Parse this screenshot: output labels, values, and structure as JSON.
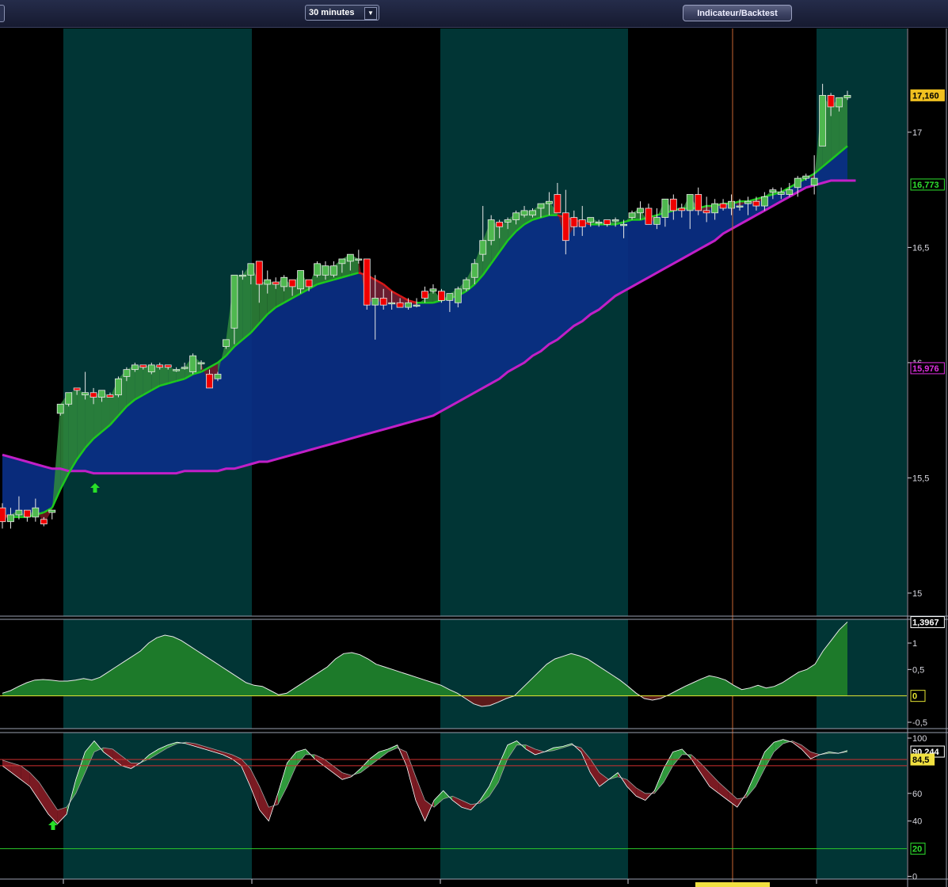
{
  "toolbar": {
    "timeframe": "30 minutes",
    "indicator_button": "Indicateur/Backtest"
  },
  "chart_data": [
    {
      "type": "candlestick",
      "ylim": [
        14.9,
        17.45
      ],
      "yticks": [
        "17",
        "16,5",
        "16",
        "15,5",
        "15"
      ],
      "last_values": {
        "price": "17,160",
        "fast_ma": "16,773",
        "slow_ma": "15,976"
      },
      "ohlc": [
        [
          15.37,
          15.39,
          15.28,
          15.31
        ],
        [
          15.31,
          15.37,
          15.28,
          15.34
        ],
        [
          15.34,
          15.42,
          15.32,
          15.36
        ],
        [
          15.36,
          15.36,
          15.31,
          15.33
        ],
        [
          15.33,
          15.41,
          15.31,
          15.37
        ],
        [
          15.32,
          15.33,
          15.29,
          15.3
        ],
        [
          15.35,
          15.36,
          15.32,
          15.36
        ],
        [
          15.78,
          15.82,
          15.77,
          15.82
        ],
        [
          15.82,
          15.87,
          15.81,
          15.87
        ],
        [
          15.89,
          15.89,
          15.86,
          15.88
        ],
        [
          15.86,
          15.96,
          15.84,
          15.87
        ],
        [
          15.87,
          15.89,
          15.82,
          15.85
        ],
        [
          15.85,
          15.88,
          15.83,
          15.88
        ],
        [
          15.86,
          15.87,
          15.85,
          15.85
        ],
        [
          15.86,
          15.94,
          15.85,
          15.93
        ],
        [
          15.94,
          15.98,
          15.92,
          15.97
        ],
        [
          15.97,
          16.0,
          15.96,
          15.99
        ],
        [
          15.99,
          15.99,
          15.97,
          15.98
        ],
        [
          15.96,
          16.0,
          15.95,
          15.99
        ],
        [
          15.99,
          16.0,
          15.97,
          15.98
        ],
        [
          15.99,
          15.99,
          15.97,
          15.98
        ],
        [
          15.97,
          15.98,
          15.96,
          15.97
        ],
        [
          15.98,
          16.0,
          15.97,
          15.98
        ],
        [
          15.96,
          16.04,
          15.95,
          16.03
        ],
        [
          16.0,
          16.01,
          15.97,
          16.0
        ],
        [
          15.95,
          15.97,
          15.89,
          15.89
        ],
        [
          15.93,
          15.96,
          15.92,
          15.95
        ],
        [
          16.07,
          16.1,
          16.06,
          16.1
        ],
        [
          16.15,
          16.32,
          16.08,
          16.38
        ],
        [
          16.38,
          16.4,
          16.36,
          16.38
        ],
        [
          16.38,
          16.43,
          16.34,
          16.43
        ],
        [
          16.44,
          16.44,
          16.26,
          16.34
        ],
        [
          16.34,
          16.4,
          16.3,
          16.36
        ],
        [
          16.35,
          16.37,
          16.32,
          16.34
        ],
        [
          16.33,
          16.38,
          16.31,
          16.37
        ],
        [
          16.36,
          16.36,
          16.29,
          16.33
        ],
        [
          16.32,
          16.4,
          16.3,
          16.4
        ],
        [
          16.36,
          16.36,
          16.31,
          16.33
        ],
        [
          16.38,
          16.44,
          16.37,
          16.43
        ],
        [
          16.38,
          16.44,
          16.36,
          16.42
        ],
        [
          16.38,
          16.44,
          16.37,
          16.42
        ],
        [
          16.43,
          16.45,
          16.39,
          16.45
        ],
        [
          16.44,
          16.47,
          16.4,
          16.47
        ],
        [
          16.45,
          16.49,
          16.43,
          16.45
        ],
        [
          16.45,
          16.45,
          16.23,
          16.25
        ],
        [
          16.25,
          16.38,
          16.1,
          16.28
        ],
        [
          16.28,
          16.32,
          16.23,
          16.25
        ],
        [
          16.26,
          16.31,
          16.23,
          16.26
        ],
        [
          16.26,
          16.28,
          16.24,
          16.24
        ],
        [
          16.24,
          16.28,
          16.23,
          16.26
        ],
        [
          16.25,
          16.28,
          16.24,
          16.25
        ],
        [
          16.31,
          16.33,
          16.26,
          16.28
        ],
        [
          16.31,
          16.34,
          16.3,
          16.32
        ],
        [
          16.31,
          16.32,
          16.26,
          16.27
        ],
        [
          16.27,
          16.3,
          16.22,
          16.3
        ],
        [
          16.26,
          16.33,
          16.24,
          16.32
        ],
        [
          16.32,
          16.37,
          16.31,
          16.36
        ],
        [
          16.37,
          16.45,
          16.34,
          16.43
        ],
        [
          16.47,
          16.68,
          16.44,
          16.53
        ],
        [
          16.53,
          16.64,
          16.51,
          16.62
        ],
        [
          16.61,
          16.62,
          16.54,
          16.59
        ],
        [
          16.61,
          16.63,
          16.58,
          16.62
        ],
        [
          16.62,
          16.66,
          16.6,
          16.65
        ],
        [
          16.64,
          16.68,
          16.63,
          16.66
        ],
        [
          16.64,
          16.67,
          16.63,
          16.66
        ],
        [
          16.67,
          16.69,
          16.63,
          16.69
        ],
        [
          16.69,
          16.74,
          16.64,
          16.7
        ],
        [
          16.73,
          16.78,
          16.69,
          16.65
        ],
        [
          16.65,
          16.75,
          16.47,
          16.53
        ],
        [
          16.63,
          16.66,
          16.55,
          16.59
        ],
        [
          16.62,
          16.68,
          16.55,
          16.59
        ],
        [
          16.61,
          16.63,
          16.59,
          16.63
        ],
        [
          16.61,
          16.62,
          16.59,
          16.61
        ],
        [
          16.62,
          16.62,
          16.59,
          16.6
        ],
        [
          16.62,
          16.63,
          16.59,
          16.62
        ],
        [
          16.6,
          16.62,
          16.54,
          16.6
        ],
        [
          16.63,
          16.66,
          16.62,
          16.65
        ],
        [
          16.65,
          16.7,
          16.62,
          16.67
        ],
        [
          16.67,
          16.69,
          16.6,
          16.6
        ],
        [
          16.6,
          16.67,
          16.58,
          16.63
        ],
        [
          16.63,
          16.71,
          16.59,
          16.71
        ],
        [
          16.71,
          16.73,
          16.62,
          16.66
        ],
        [
          16.67,
          16.69,
          16.63,
          16.66
        ],
        [
          16.66,
          16.73,
          16.58,
          16.73
        ],
        [
          16.73,
          16.76,
          16.64,
          16.66
        ],
        [
          16.66,
          16.72,
          16.61,
          16.65
        ],
        [
          16.65,
          16.71,
          16.62,
          16.69
        ],
        [
          16.69,
          16.71,
          16.66,
          16.67
        ],
        [
          16.67,
          16.73,
          16.64,
          16.7
        ],
        [
          16.68,
          16.71,
          16.66,
          16.68
        ],
        [
          16.69,
          16.72,
          16.64,
          16.7
        ],
        [
          16.7,
          16.72,
          16.66,
          16.68
        ],
        [
          16.68,
          16.74,
          16.66,
          16.72
        ],
        [
          16.74,
          16.76,
          16.71,
          16.75
        ],
        [
          16.73,
          16.76,
          16.71,
          16.74
        ],
        [
          16.73,
          16.78,
          16.72,
          16.75
        ],
        [
          16.76,
          16.81,
          16.72,
          16.8
        ],
        [
          16.8,
          16.82,
          16.79,
          16.81
        ],
        [
          16.77,
          16.9,
          16.73,
          16.8
        ],
        [
          16.94,
          17.21,
          16.98,
          17.16
        ],
        [
          17.16,
          17.17,
          17.07,
          17.11
        ],
        [
          17.11,
          17.15,
          17.09,
          17.15
        ],
        [
          17.15,
          17.18,
          17.14,
          17.16
        ]
      ],
      "fast_ma": [
        15.34,
        15.33,
        15.33,
        15.33,
        15.34,
        15.35,
        15.37,
        15.45,
        15.52,
        15.58,
        15.63,
        15.67,
        15.7,
        15.73,
        15.77,
        15.81,
        15.84,
        15.86,
        15.88,
        15.9,
        15.91,
        15.92,
        15.93,
        15.95,
        15.96,
        15.98,
        16.0,
        16.03,
        16.07,
        16.1,
        16.13,
        16.17,
        16.21,
        16.24,
        16.26,
        16.28,
        16.3,
        16.32,
        16.34,
        16.35,
        16.36,
        16.37,
        16.38,
        16.39,
        16.38,
        16.36,
        16.34,
        16.31,
        16.29,
        16.27,
        16.26,
        16.26,
        16.26,
        16.27,
        16.28,
        16.29,
        16.31,
        16.34,
        16.38,
        16.43,
        16.48,
        16.53,
        16.57,
        16.6,
        16.62,
        16.63,
        16.64,
        16.64,
        16.63,
        16.62,
        16.61,
        16.6,
        16.6,
        16.6,
        16.6,
        16.61,
        16.62,
        16.62,
        16.63,
        16.64,
        16.65,
        16.66,
        16.67,
        16.67,
        16.67,
        16.68,
        16.68,
        16.69,
        16.69,
        16.7,
        16.7,
        16.71,
        16.72,
        16.73,
        16.74,
        16.76,
        16.78,
        16.8,
        16.82,
        16.85,
        16.88,
        16.91,
        16.94,
        16.96
      ],
      "slow_ma": [
        15.6,
        15.59,
        15.58,
        15.57,
        15.56,
        15.55,
        15.54,
        15.54,
        15.53,
        15.53,
        15.53,
        15.52,
        15.52,
        15.52,
        15.52,
        15.52,
        15.52,
        15.52,
        15.52,
        15.52,
        15.52,
        15.52,
        15.53,
        15.53,
        15.53,
        15.53,
        15.53,
        15.54,
        15.54,
        15.55,
        15.56,
        15.57,
        15.57,
        15.58,
        15.59,
        15.6,
        15.61,
        15.62,
        15.63,
        15.64,
        15.65,
        15.66,
        15.67,
        15.68,
        15.69,
        15.7,
        15.71,
        15.72,
        15.73,
        15.74,
        15.75,
        15.76,
        15.77,
        15.79,
        15.81,
        15.83,
        15.85,
        15.87,
        15.89,
        15.91,
        15.93,
        15.96,
        15.98,
        16.0,
        16.03,
        16.05,
        16.08,
        16.1,
        16.13,
        16.16,
        16.18,
        16.21,
        16.23,
        16.26,
        16.29,
        16.31,
        16.33,
        16.35,
        16.37,
        16.39,
        16.41,
        16.43,
        16.45,
        16.47,
        16.49,
        16.51,
        16.53,
        16.56,
        16.58,
        16.6,
        16.62,
        16.64,
        16.66,
        16.68,
        16.7,
        16.72,
        16.74,
        16.76,
        16.77,
        16.78,
        16.79,
        16.79,
        16.79,
        16.79
      ]
    },
    {
      "type": "area",
      "ylim": [
        -0.62,
        1.45
      ],
      "yticks": [
        "1",
        "0,5",
        "0",
        "-0,5"
      ],
      "last_value": "1,3967",
      "zero_label": "0",
      "values": [
        0.05,
        0.1,
        0.18,
        0.25,
        0.3,
        0.31,
        0.3,
        0.28,
        0.28,
        0.3,
        0.33,
        0.3,
        0.35,
        0.45,
        0.55,
        0.65,
        0.75,
        0.85,
        1.0,
        1.1,
        1.15,
        1.12,
        1.05,
        0.95,
        0.85,
        0.75,
        0.65,
        0.55,
        0.45,
        0.35,
        0.25,
        0.2,
        0.18,
        0.1,
        0.02,
        0.05,
        0.15,
        0.25,
        0.35,
        0.45,
        0.55,
        0.7,
        0.8,
        0.82,
        0.78,
        0.7,
        0.6,
        0.55,
        0.5,
        0.45,
        0.4,
        0.35,
        0.3,
        0.25,
        0.2,
        0.12,
        0.05,
        -0.05,
        -0.15,
        -0.2,
        -0.18,
        -0.12,
        -0.05,
        0.0,
        0.15,
        0.3,
        0.45,
        0.6,
        0.7,
        0.75,
        0.8,
        0.76,
        0.7,
        0.6,
        0.5,
        0.4,
        0.3,
        0.18,
        0.05,
        -0.05,
        -0.08,
        -0.05,
        0.02,
        0.1,
        0.18,
        0.25,
        0.32,
        0.38,
        0.35,
        0.3,
        0.2,
        0.12,
        0.15,
        0.2,
        0.15,
        0.18,
        0.25,
        0.35,
        0.45,
        0.5,
        0.6,
        0.85,
        1.05,
        1.25,
        1.4
      ]
    },
    {
      "type": "line",
      "ylim": [
        -2,
        104
      ],
      "yticks": [
        "100",
        "80",
        "60",
        "40",
        "20",
        "0"
      ],
      "last_value": "90,244",
      "upper_level": "84,5",
      "lower_level": "20",
      "fast": [
        80,
        75,
        70,
        65,
        55,
        45,
        38,
        45,
        70,
        90,
        98,
        90,
        85,
        80,
        78,
        82,
        88,
        92,
        95,
        97,
        96,
        94,
        92,
        90,
        88,
        85,
        80,
        65,
        48,
        40,
        60,
        82,
        90,
        92,
        85,
        80,
        75,
        70,
        72,
        78,
        85,
        90,
        92,
        95,
        80,
        55,
        40,
        55,
        62,
        55,
        50,
        48,
        55,
        65,
        80,
        95,
        98,
        92,
        88,
        90,
        93,
        94,
        96,
        90,
        75,
        65,
        70,
        75,
        65,
        58,
        55,
        62,
        78,
        90,
        92,
        85,
        75,
        65,
        60,
        55,
        50,
        60,
        75,
        90,
        97,
        99,
        97,
        92,
        85,
        88,
        90,
        89,
        91
      ],
      "slow": [
        84,
        82,
        80,
        75,
        68,
        58,
        48,
        50,
        60,
        75,
        90,
        93,
        92,
        87,
        82,
        82,
        85,
        89,
        93,
        96,
        97,
        96,
        94,
        92,
        90,
        88,
        85,
        78,
        65,
        50,
        52,
        65,
        80,
        88,
        88,
        85,
        80,
        75,
        73,
        75,
        80,
        85,
        90,
        93,
        90,
        72,
        55,
        50,
        56,
        58,
        55,
        52,
        53,
        58,
        68,
        85,
        95,
        95,
        92,
        90,
        91,
        93,
        95,
        93,
        85,
        75,
        70,
        72,
        70,
        64,
        60,
        60,
        68,
        80,
        88,
        88,
        82,
        75,
        68,
        62,
        56,
        57,
        65,
        78,
        90,
        96,
        98,
        95,
        90,
        88,
        89,
        89,
        90
      ]
    }
  ]
}
